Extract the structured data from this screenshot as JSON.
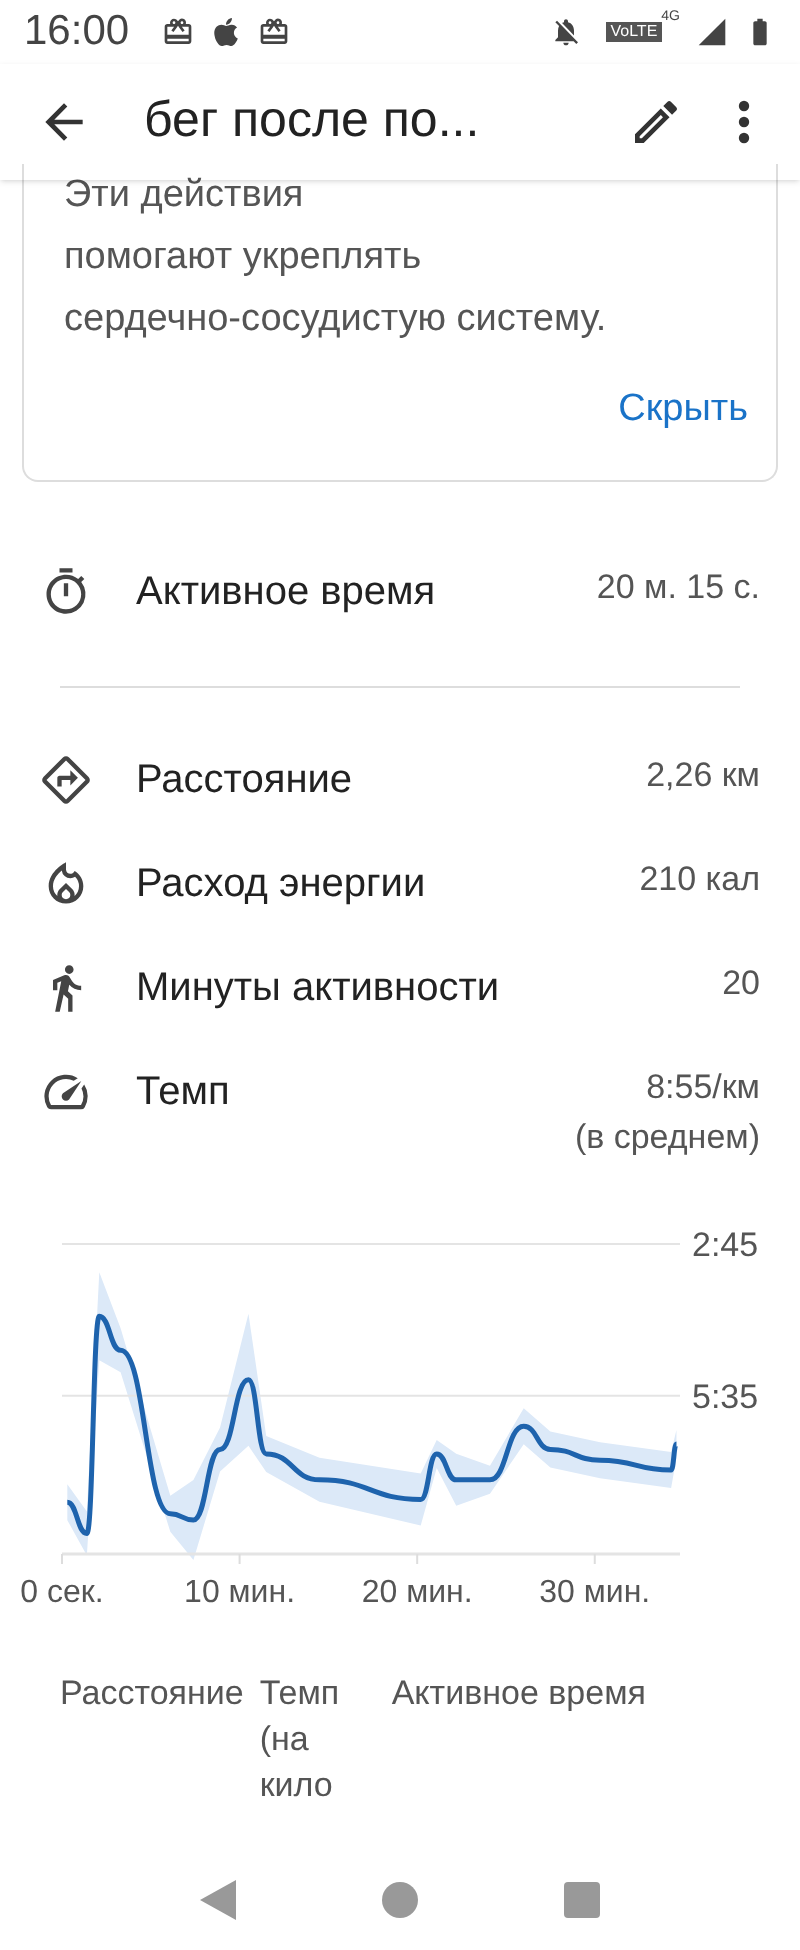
{
  "status_bar": {
    "time": "16:00",
    "network_badge": "VoLTE",
    "network_type": "4G"
  },
  "app_bar": {
    "title": "бег после по..."
  },
  "info_card": {
    "lines": [
      "Эти действия",
      "помогают укреплять",
      "сердечно-сосудистую систему."
    ],
    "action": "Скрыть"
  },
  "active_time": {
    "kind": "timer",
    "label": "Активное время",
    "value": "20 м. 15 с."
  },
  "metrics": [
    {
      "kind": "distance",
      "label": "Расстояние",
      "value": "2,26 км"
    },
    {
      "kind": "energy",
      "label": "Расход энергии",
      "value": "210 кал"
    },
    {
      "kind": "activity",
      "label": "Минуты активности",
      "value": "20"
    },
    {
      "kind": "pace",
      "label": "Темп",
      "value": "8:55/км",
      "note": "(в среднем)"
    }
  ],
  "chart_data": {
    "type": "line",
    "x": [
      0.3,
      1.4,
      2.1,
      3.3,
      6.1,
      7.4,
      8.9,
      10.5,
      11.5,
      14.5,
      20.2,
      21.1,
      22.2,
      24.1,
      26,
      27.5,
      30.3,
      34.3,
      34.6
    ],
    "series": [
      {
        "color": "#1e63ad",
        "values": [
          454,
          489,
          246,
          284,
          467,
          474,
          395,
          317,
          400,
          429,
          451,
          400,
          429,
          429,
          369,
          395,
          407,
          418,
          389
        ]
      }
    ],
    "xlim": [
      0,
      34.8
    ],
    "ylim": [
      512,
      165
    ],
    "xticks": [
      {
        "value": 0,
        "label": "0 сек."
      },
      {
        "value": 10,
        "label": "10 мин."
      },
      {
        "value": 20,
        "label": "20 мин."
      },
      {
        "value": 30,
        "label": "30 мин."
      }
    ],
    "yticks": [
      {
        "value": 165,
        "label": "2:45"
      },
      {
        "value": 335,
        "label": "5:35"
      }
    ]
  },
  "table": {
    "columns": [
      "Расстояние",
      "Темп (на кило",
      "Активное время"
    ]
  }
}
